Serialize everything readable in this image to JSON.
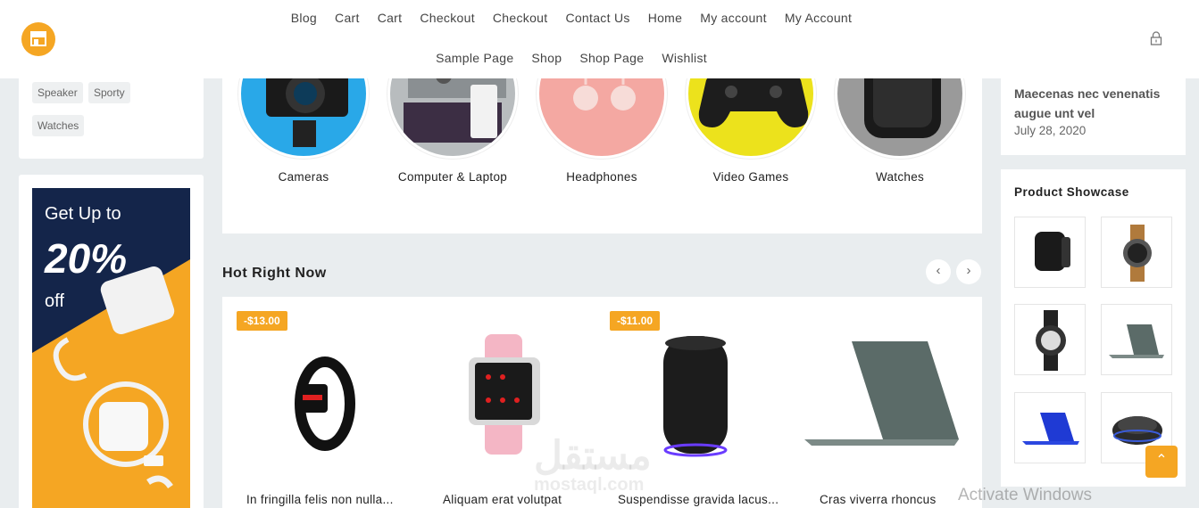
{
  "header": {
    "nav_row1": [
      "Blog",
      "Cart",
      "Cart",
      "Checkout",
      "Checkout",
      "Contact Us",
      "Home",
      "My account",
      "My Account"
    ],
    "nav_row2": [
      "Sample Page",
      "Shop",
      "Shop Page",
      "Wishlist"
    ],
    "logo_icon": "store-icon",
    "account_icon": "lock-icon"
  },
  "sidebar_left": {
    "tags": [
      "Speaker",
      "Sporty",
      "Watches"
    ],
    "ad": {
      "line1": "Get Up to",
      "line2": "20%",
      "line3": "off"
    }
  },
  "categories": [
    {
      "name": "Cameras"
    },
    {
      "name": "Computer & Laptop"
    },
    {
      "name": "Headphones"
    },
    {
      "name": "Video Games"
    },
    {
      "name": "Watches"
    }
  ],
  "hot": {
    "title": "Hot Right Now",
    "prev_icon": "chevron-left-icon",
    "next_icon": "chevron-right-icon",
    "products": [
      {
        "name": "In fringilla felis non nulla...",
        "badge": "-$13.00"
      },
      {
        "name": "Aliquam erat volutpat",
        "badge": ""
      },
      {
        "name": "Suspendisse gravida lacus...",
        "badge": "-$11.00"
      },
      {
        "name": "Cras viverra rhoncus",
        "badge": ""
      }
    ]
  },
  "sidebar_right": {
    "post": {
      "title": "Maecenas nec venenatis augue unt vel",
      "date": "July 28, 2020"
    },
    "showcase_title": "Product Showcase"
  },
  "overlay": {
    "watermark": "مستقل",
    "watermark_sub": "mostaql.com",
    "activate": "Activate Windows"
  },
  "colors": {
    "accent": "#f5a623",
    "navy": "#14254a"
  }
}
